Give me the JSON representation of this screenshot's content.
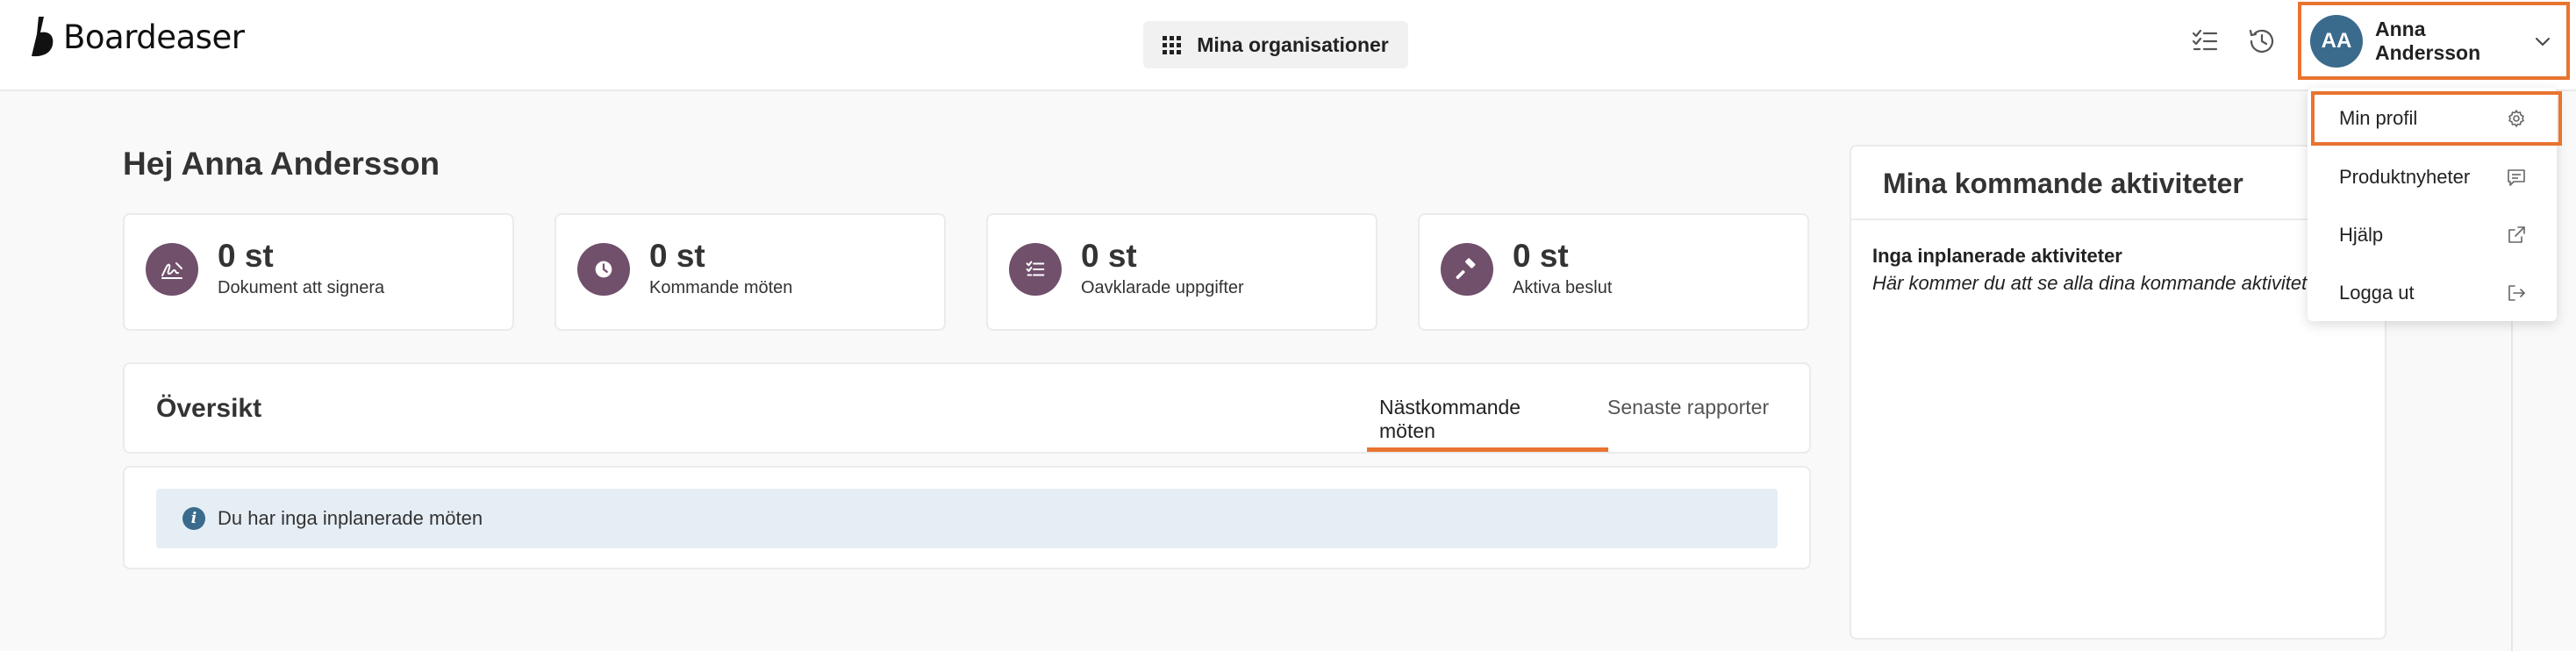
{
  "header": {
    "logo_text": "Boardeaser",
    "org_button_label": "Mina organisationer",
    "user": {
      "initials": "AA",
      "name": "Anna Andersson"
    }
  },
  "greeting": "Hej Anna Andersson",
  "stats": [
    {
      "value": "0 st",
      "label": "Dokument att signera",
      "icon": "signature-icon"
    },
    {
      "value": "0 st",
      "label": "Kommande möten",
      "icon": "clock-icon"
    },
    {
      "value": "0 st",
      "label": "Oavklarade uppgifter",
      "icon": "task-list-icon"
    },
    {
      "value": "0 st",
      "label": "Aktiva beslut",
      "icon": "gavel-icon"
    }
  ],
  "overview": {
    "title": "Översikt",
    "tabs": [
      {
        "label": "Nästkommande möten",
        "active": true
      },
      {
        "label": "Senaste rapporter",
        "active": false
      }
    ],
    "info_message": "Du har inga inplanerade möten"
  },
  "activities": {
    "title": "Mina kommande aktiviteter",
    "empty_title": "Inga inplanerade aktiviteter",
    "empty_hint": "Här kommer du att se alla dina kommande aktiviteter"
  },
  "profile_menu": {
    "items": [
      {
        "label": "Min profil",
        "icon": "gear-icon"
      },
      {
        "label": "Produktnyheter",
        "icon": "message-icon"
      },
      {
        "label": "Hjälp",
        "icon": "external-link-icon"
      },
      {
        "label": "Logga ut",
        "icon": "logout-icon"
      }
    ]
  },
  "colors": {
    "accent": "#e8742f",
    "stat_icon_bg": "#71506c",
    "avatar_bg": "#3a6b8c",
    "info_bg": "#e6eef5"
  }
}
